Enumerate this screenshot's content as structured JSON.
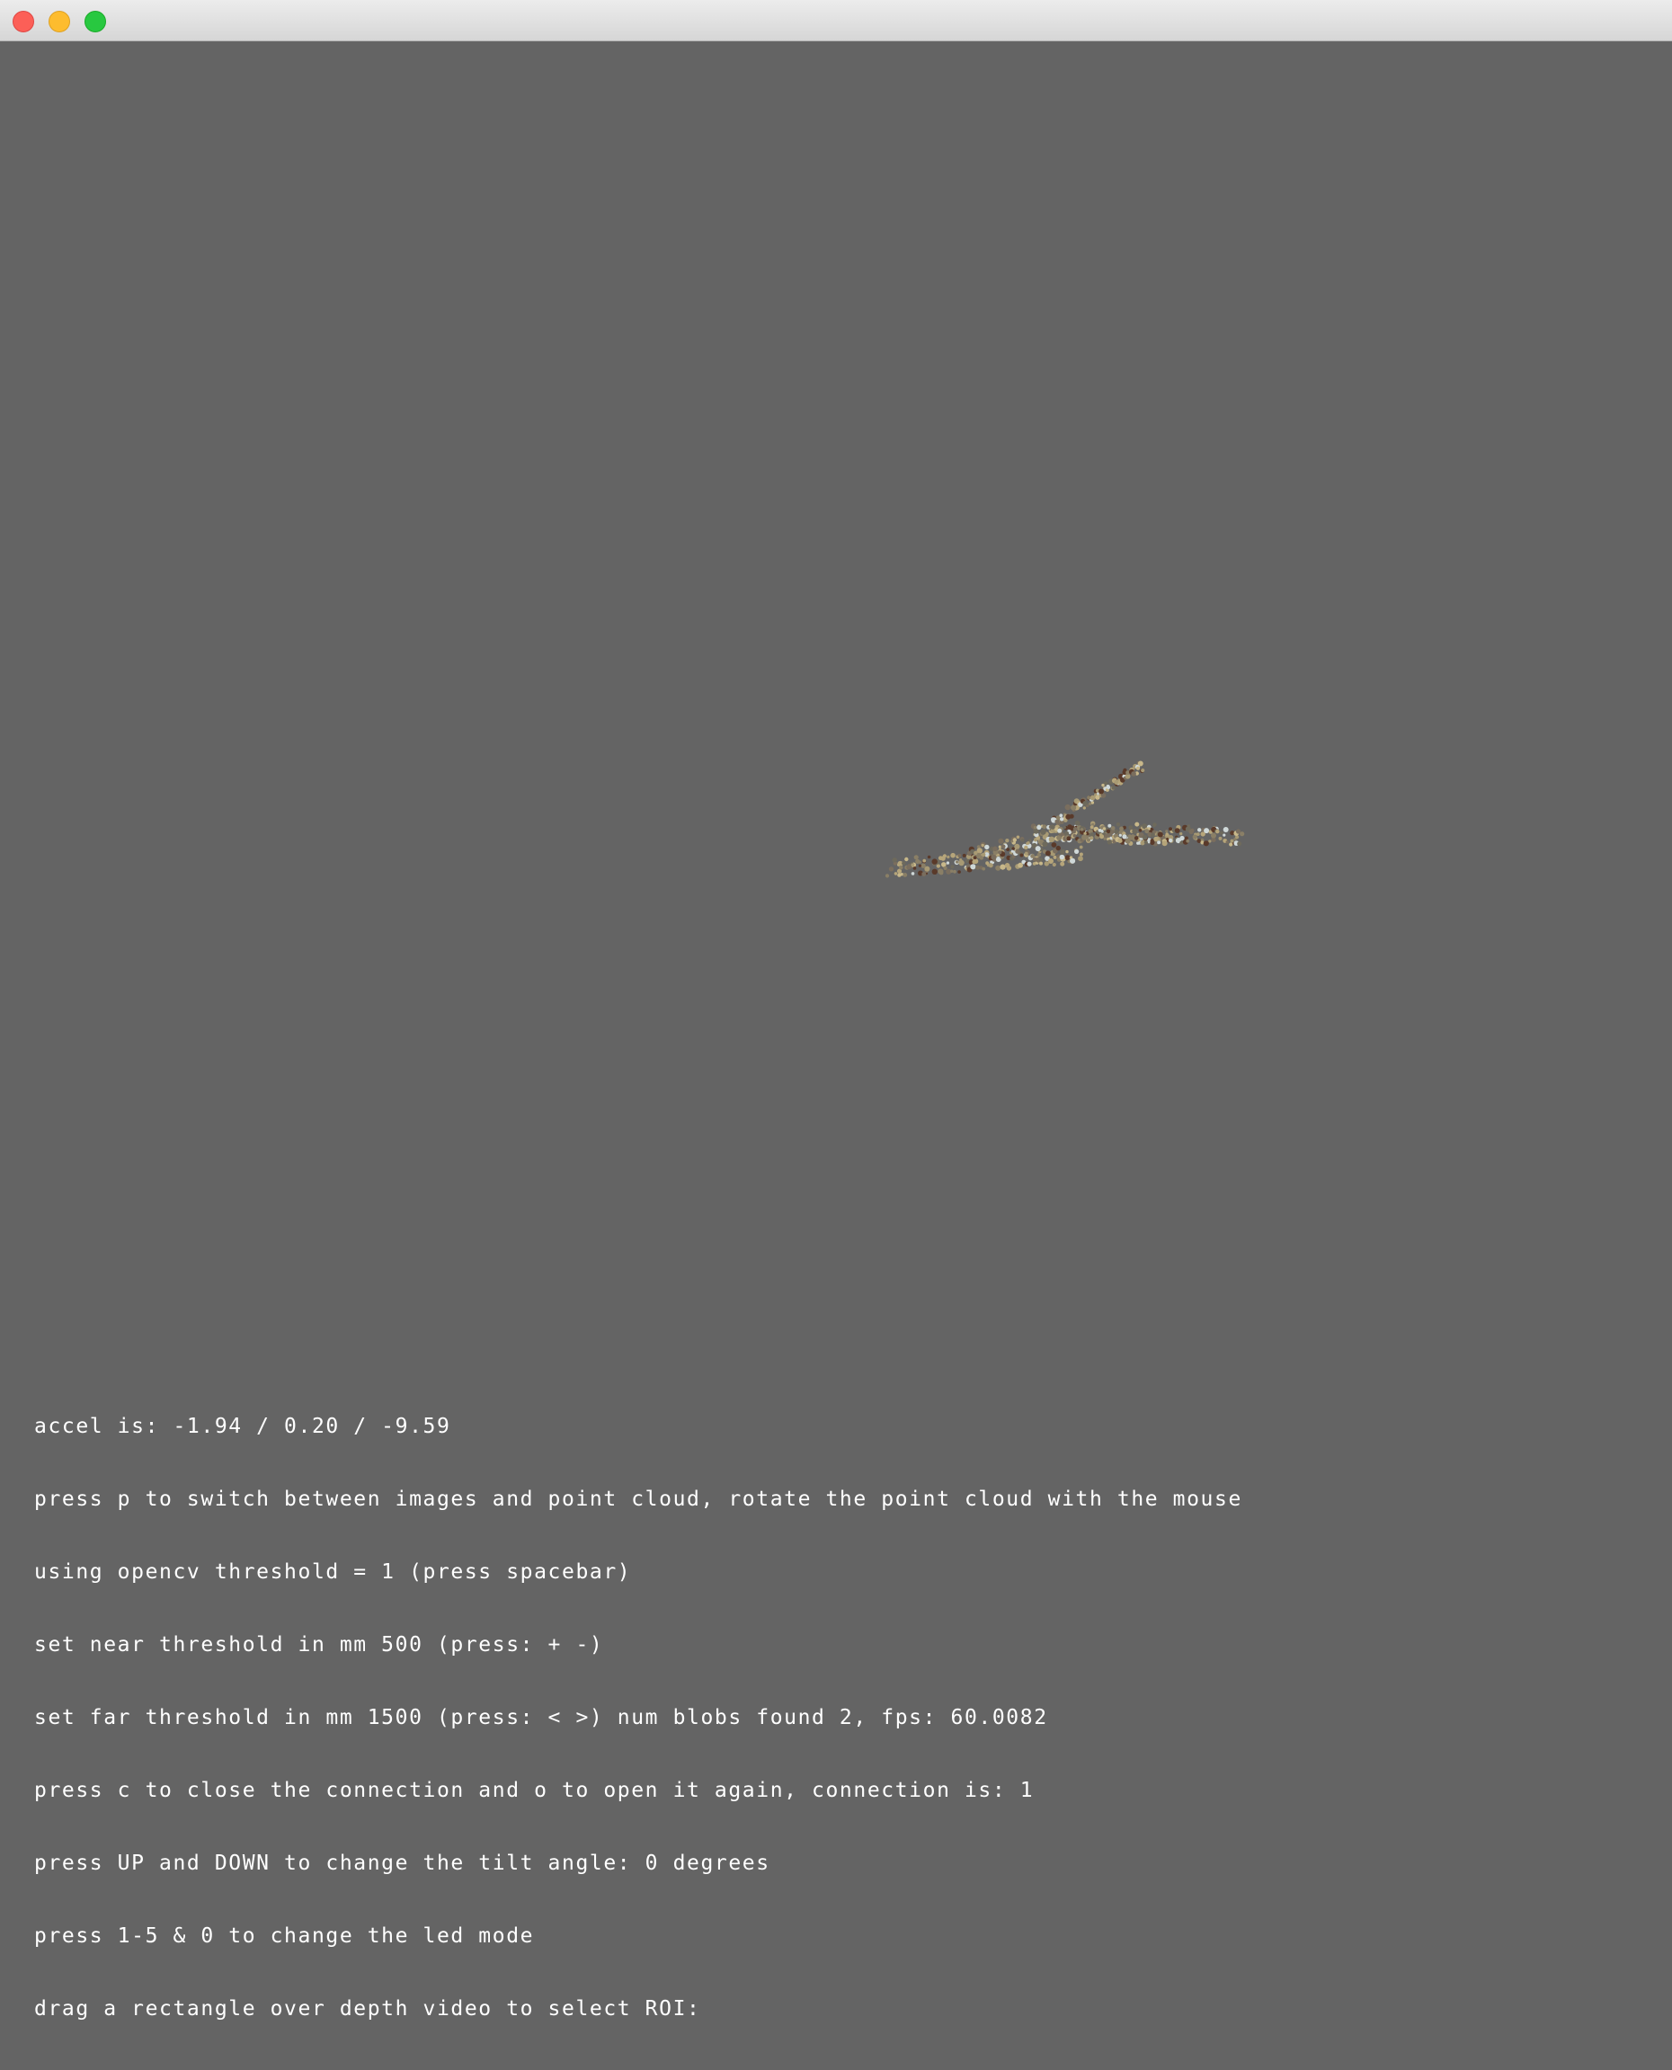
{
  "window": {
    "controls": [
      {
        "name": "close-button",
        "icon": "close-circle",
        "color": "#fc5f57"
      },
      {
        "name": "minimize-button",
        "icon": "minimize-circle",
        "color": "#fdbc2e"
      },
      {
        "name": "zoom-button",
        "icon": "zoom-circle",
        "color": "#28c840"
      }
    ]
  },
  "viewport": {
    "background_color": "#646464",
    "content": "point-cloud",
    "point_colors": [
      "#a89a74",
      "#8a7f66",
      "#c8b88a",
      "#6e6a5c",
      "#b6a57a",
      "#7a6e5e",
      "#cfd8d8",
      "#5a3a2a"
    ]
  },
  "overlay": {
    "text_color": "#ffffff",
    "lines": [
      "accel is: -1.94 / 0.20 / -9.59",
      "press p to switch between images and point cloud, rotate the point cloud with the mouse",
      "using opencv threshold = 1 (press spacebar)",
      "set near threshold in mm 500 (press: + -)",
      "set far threshold in mm 1500 (press: < >) num blobs found 2, fps: 60.0082",
      "press c to close the connection and o to open it again, connection is: 1",
      "press UP and DOWN to change the tilt angle: 0 degrees",
      "press 1-5 & 0 to change the led mode",
      "drag a rectangle over depth video to select ROI:"
    ]
  }
}
